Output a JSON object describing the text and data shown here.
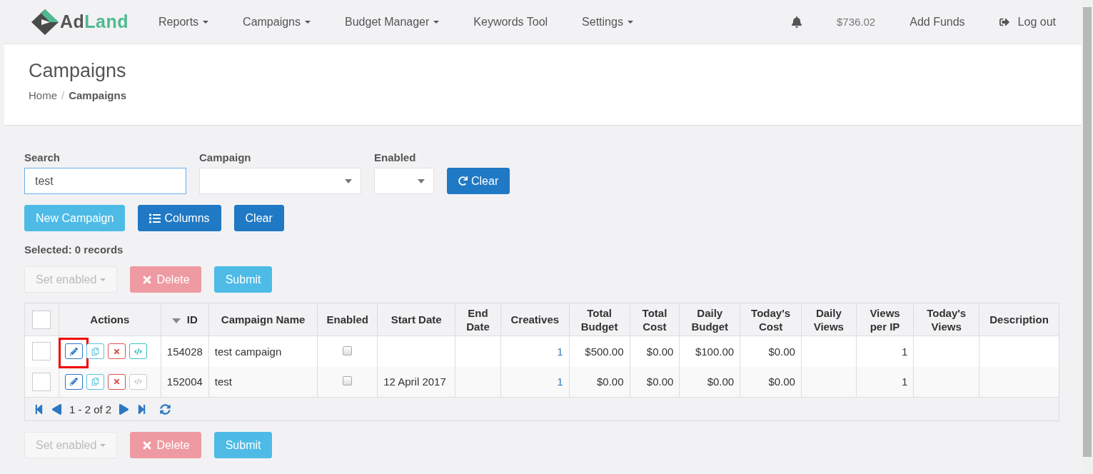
{
  "nav": {
    "logo": {
      "first": "Ad",
      "second": "Land"
    },
    "items": [
      {
        "label": "Reports",
        "dropdown": true
      },
      {
        "label": "Campaigns",
        "dropdown": true
      },
      {
        "label": "Budget Manager",
        "dropdown": true
      },
      {
        "label": "Keywords Tool",
        "dropdown": false
      },
      {
        "label": "Settings",
        "dropdown": true
      }
    ],
    "balance": "$736.02",
    "add_funds": "Add Funds",
    "logout": "Log out"
  },
  "page": {
    "title": "Campaigns",
    "breadcrumb": [
      {
        "label": "Home",
        "current": false
      },
      {
        "label": "Campaigns",
        "current": true
      }
    ],
    "separator": "/"
  },
  "filters": {
    "search": {
      "label": "Search",
      "value": "test"
    },
    "campaign": {
      "label": "Campaign"
    },
    "enabled": {
      "label": "Enabled"
    },
    "clear": "Clear"
  },
  "toolbar": [
    {
      "label": "New Campaign",
      "kind": "new"
    },
    {
      "label": "Columns",
      "kind": "columns"
    },
    {
      "label": "Clear",
      "kind": "clear"
    }
  ],
  "selected_text": "Selected: 0 records",
  "bulk_top": [
    {
      "label": "Set enabled",
      "kind": "set",
      "disabled": true
    },
    {
      "label": "Delete",
      "kind": "delete",
      "disabled": true
    },
    {
      "label": "Submit",
      "kind": "submit",
      "disabled": false
    }
  ],
  "table": {
    "select_all": false,
    "columns": [
      {
        "label": "Actions",
        "sorted": false
      },
      {
        "label": "ID",
        "sorted": true
      },
      {
        "label": "Campaign Name",
        "sorted": false
      },
      {
        "label": "Enabled",
        "sorted": false
      },
      {
        "label": "Start Date",
        "sorted": false
      },
      {
        "label": "End Date",
        "sorted": false
      },
      {
        "label": "Creatives",
        "sorted": false
      },
      {
        "label": "Total Budget",
        "sorted": false
      },
      {
        "label": "Total Cost",
        "sorted": false
      },
      {
        "label": "Daily Budget",
        "sorted": false
      },
      {
        "label": "Today's Cost",
        "sorted": false
      },
      {
        "label": "Daily Views",
        "sorted": false
      },
      {
        "label": "Views per IP",
        "sorted": false
      },
      {
        "label": "Today's Views",
        "sorted": false
      },
      {
        "label": "Description",
        "sorted": false
      }
    ],
    "rows": [
      {
        "checked": false,
        "actions": [
          {
            "kind": "edit",
            "disabled": false,
            "highlighted": true
          },
          {
            "kind": "copy",
            "disabled": false,
            "highlighted": false
          },
          {
            "kind": "delete",
            "disabled": false,
            "highlighted": false
          },
          {
            "kind": "code",
            "disabled": false,
            "highlighted": false
          }
        ],
        "id": "154028",
        "name": "test campaign",
        "enabled": false,
        "creatives": "1",
        "total_budget": "$500.00",
        "total_cost": "$0.00",
        "daily_budget": "$100.00",
        "todays_cost": "$0.00",
        "views_per_ip": "1"
      },
      {
        "checked": false,
        "actions": [
          {
            "kind": "edit",
            "disabled": false,
            "highlighted": false
          },
          {
            "kind": "copy",
            "disabled": false,
            "highlighted": false
          },
          {
            "kind": "delete",
            "disabled": false,
            "highlighted": false
          },
          {
            "kind": "code",
            "disabled": true,
            "highlighted": false
          }
        ],
        "id": "152004",
        "name": "test",
        "enabled": false,
        "start_date": "12 April 2017",
        "creatives": "1",
        "total_budget": "$0.00",
        "total_cost": "$0.00",
        "daily_budget": "$0.00",
        "todays_cost": "$0.00",
        "views_per_ip": "1"
      }
    ],
    "pager": {
      "range": "1 - 2 of 2"
    }
  },
  "bulk_bottom": [
    {
      "label": "Set enabled",
      "kind": "set",
      "disabled": true
    },
    {
      "label": "Delete",
      "kind": "delete",
      "disabled": true
    },
    {
      "label": "Submit",
      "kind": "submit",
      "disabled": false
    }
  ]
}
